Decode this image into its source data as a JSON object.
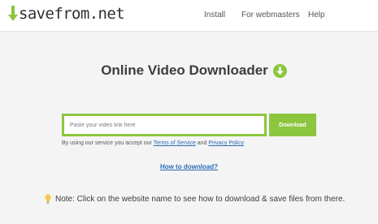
{
  "header": {
    "logo_text": "savefrom.net",
    "nav": {
      "install": "Install",
      "webmasters": "For webmasters",
      "help": "Help"
    }
  },
  "main": {
    "title": "Online Video Downloader",
    "title_icon": "green-down-arrow-icon",
    "search": {
      "placeholder": "Paste your video link here",
      "value": ""
    },
    "download_label": "Download",
    "terms": {
      "prefix": "By using our service you accept our ",
      "tos_link": "Terms of Service",
      "and": " and ",
      "privacy_link": "Privacy Policy"
    },
    "howto_link": "How to download?"
  },
  "note": {
    "icon": "lightbulb-icon",
    "text": "Note: Click on the website name to see how to download & save files from there."
  },
  "colors": {
    "accent_green": "#8cc63f",
    "link_blue": "#2a6bb5",
    "background": "#f4f4f4"
  }
}
